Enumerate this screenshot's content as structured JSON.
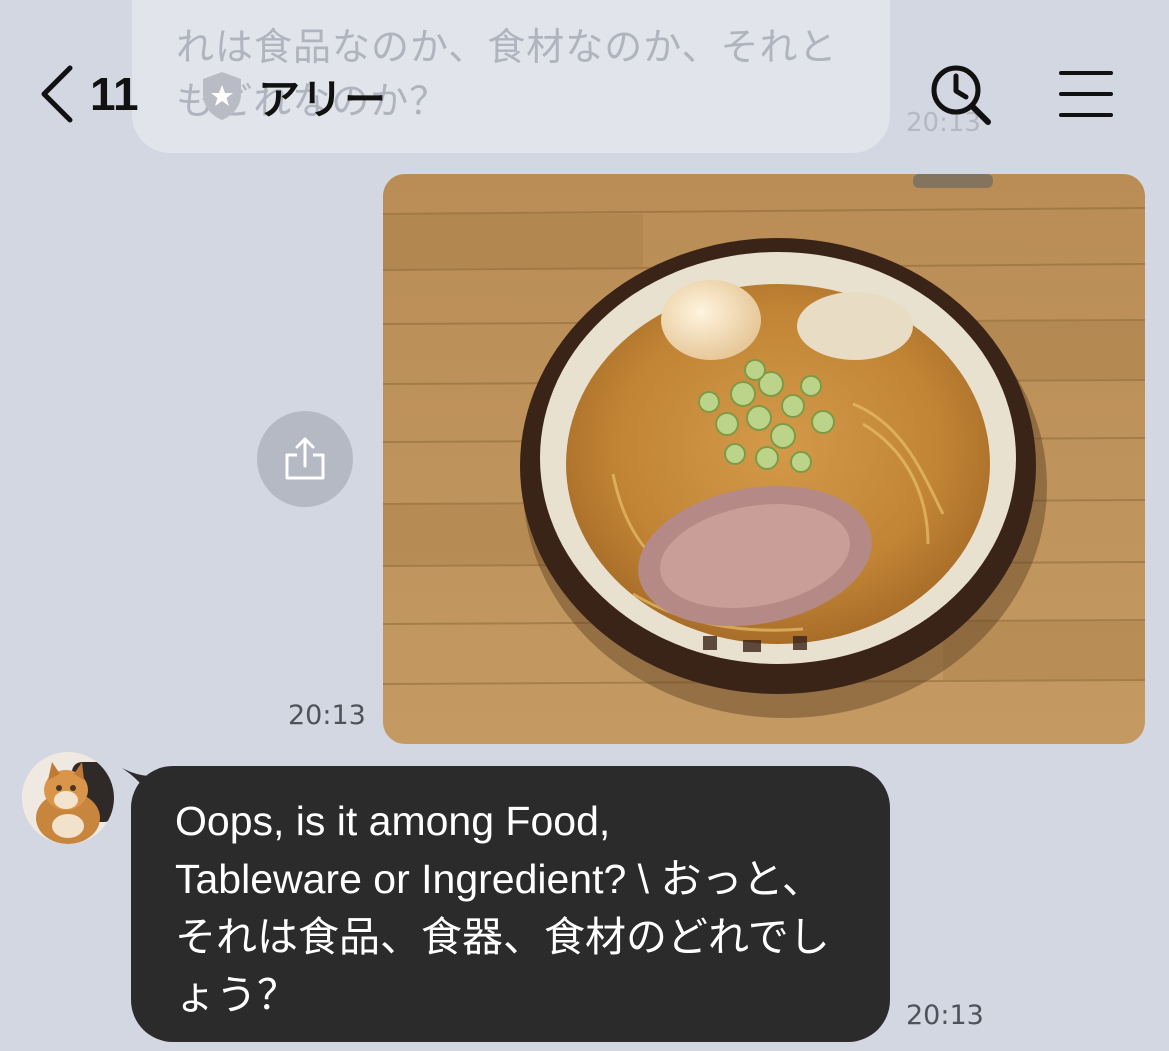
{
  "previous_message": {
    "text": "れは食品なのか、食材なのか、それともどれなのか？",
    "time": "20:13"
  },
  "header": {
    "back_count": "11",
    "back_icon": "chevron-left-icon",
    "badge_icon": "shield-star-icon",
    "title": "アリー",
    "search_icon": "clock-search-icon",
    "menu_icon": "hamburger-menu-icon"
  },
  "photo_message": {
    "description_icon": "photo-ramen",
    "time": "20:13",
    "share_icon": "share-upload-icon"
  },
  "incoming_message": {
    "avatar_icon": "cat-avatar",
    "text": "Oops, is it among Food,\nTableware or Ingredient? \\ おっと、それは食品、食器、食材のどれでしょう？",
    "time": "20:13"
  },
  "colors": {
    "background": "#d3d7e2",
    "incoming_bubble": "#2b2b2b",
    "share_button": "#b5b9c3"
  }
}
